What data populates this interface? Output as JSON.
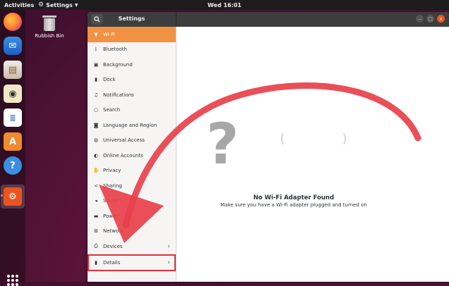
{
  "topbar": {
    "activities": "Activities",
    "app_menu": "Settings",
    "clock": "Wed 16:01"
  },
  "desktop": {
    "rubbish_bin_label": "Rubbish Bin"
  },
  "dock": {
    "items": [
      {
        "name": "firefox-icon"
      },
      {
        "name": "thunderbird-icon"
      },
      {
        "name": "files-icon"
      },
      {
        "name": "rhythmbox-icon"
      },
      {
        "name": "libreoffice-writer-icon"
      },
      {
        "name": "software-icon"
      },
      {
        "name": "help-icon"
      },
      {
        "name": "settings-icon"
      }
    ]
  },
  "window": {
    "title": "Settings"
  },
  "sidebar": {
    "items": [
      {
        "label": "Wi-Fi",
        "icon": "wifi-icon"
      },
      {
        "label": "Bluetooth",
        "icon": "bluetooth-icon"
      },
      {
        "label": "Background",
        "icon": "background-icon"
      },
      {
        "label": "Dock",
        "icon": "dock-icon"
      },
      {
        "label": "Notifications",
        "icon": "bell-icon"
      },
      {
        "label": "Search",
        "icon": "search-icon"
      },
      {
        "label": "Language and Region",
        "icon": "camera-icon"
      },
      {
        "label": "Universal Access",
        "icon": "accessibility-icon"
      },
      {
        "label": "Online Accounts",
        "icon": "cloud-icon"
      },
      {
        "label": "Privacy",
        "icon": "hand-icon"
      },
      {
        "label": "Sharing",
        "icon": "share-icon"
      },
      {
        "label": "Sound",
        "icon": "speaker-icon"
      },
      {
        "label": "Power",
        "icon": "power-icon"
      },
      {
        "label": "Network",
        "icon": "network-icon"
      },
      {
        "label": "Devices",
        "icon": "printer-icon"
      },
      {
        "label": "Details",
        "icon": "info-icon"
      }
    ]
  },
  "main": {
    "empty_title": "No Wi-Fi Adapter Found",
    "empty_subtitle": "Make sure you have a Wi-Fi adapter plugged and turned on"
  },
  "colors": {
    "accent": "#f29142",
    "annotation": "#e0303a"
  }
}
